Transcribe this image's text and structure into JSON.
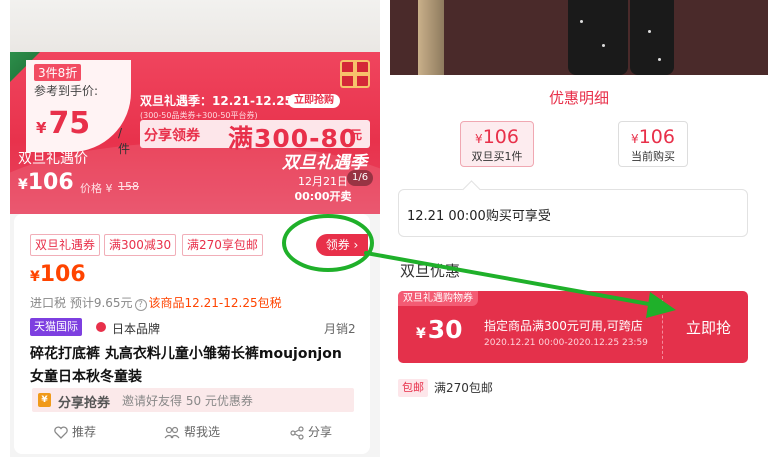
{
  "left": {
    "discount_badge": "3件8折",
    "ref_price_label": "参考到手价:",
    "ref_price_currency": "¥",
    "ref_price": "75",
    "ref_price_unit": "/件",
    "sale_title": "双旦礼遇季：12.21-12.25",
    "sale_button": "立即抢购",
    "sale_small": "(300-50品类券+300-50平台券)",
    "share_coupon": "分享领券",
    "share_threshold": "满300-80",
    "share_unit": "元",
    "page_indicator": "1/6",
    "holiday_price_label": "双旦礼遇价",
    "holiday_currency": "¥",
    "holiday_price": "106",
    "orig_price_label": "价格 ¥",
    "orig_price": "158",
    "event_logo": "双旦礼遇季",
    "event_date": "12月21日",
    "event_start": "00:00开卖",
    "chips": [
      "双旦礼遇券",
      "满300减30",
      "满270享包邮"
    ],
    "coupon_button": "领券 ›",
    "price_currency": "¥",
    "price": "106",
    "tax_prefix": "进口税 预计9.65元",
    "tax_help": "?",
    "tax_highlight": "该商品12.21-12.25包税",
    "tmall_badge": "天猫国际",
    "brand_origin": "日本品牌",
    "monthly_sales": "月销2",
    "title_line1": "碎花打底裤 丸高衣料儿童小雏菊长裤moujonjon",
    "title_line2": "女童日本秋冬童装",
    "share_icon_text": "¥",
    "share_action": "分享抢券",
    "share_invite": "邀请好友得 50 元优惠券",
    "actions": [
      "推荐",
      "帮我选",
      "分享"
    ]
  },
  "right": {
    "sheet_title": "优惠明细",
    "options": [
      {
        "currency": "¥",
        "price": "106",
        "label": "双旦买1件"
      },
      {
        "currency": "¥",
        "price": "106",
        "label": "当前购买"
      }
    ],
    "notice": "12.21 00:00购买可享受",
    "section_title": "双旦优惠",
    "voucher": {
      "tag": "双旦礼遇购物券",
      "currency": "¥",
      "amount": "30",
      "desc": "指定商品满300元可用,可跨店",
      "date_range": "2020.12.21 00:00-2020.12.25 23:59",
      "button": "立即抢"
    },
    "shipping_tag": "包邮",
    "shipping_text": "满270包邮"
  },
  "colors": {
    "accent": "#e8304a",
    "annotation_green": "#1fb02a",
    "tmall_purple": "#7d3fe0"
  }
}
